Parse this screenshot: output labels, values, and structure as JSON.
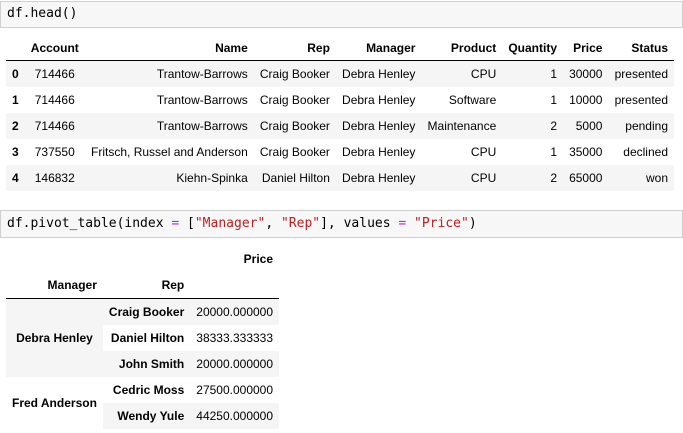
{
  "cell1": {
    "code": "df.head()"
  },
  "cell2": {
    "code_parts": [
      "df.pivot_table(index ",
      "=",
      " [",
      "\"Manager\"",
      ", ",
      "\"Rep\"",
      "], values ",
      "=",
      " ",
      "\"Price\"",
      ")"
    ]
  },
  "head_table": {
    "columns": [
      "Account",
      "Name",
      "Rep",
      "Manager",
      "Product",
      "Quantity",
      "Price",
      "Status"
    ],
    "rows": [
      {
        "index": "0",
        "values": [
          "714466",
          "Trantow-Barrows",
          "Craig Booker",
          "Debra Henley",
          "CPU",
          "1",
          "30000",
          "presented"
        ]
      },
      {
        "index": "1",
        "values": [
          "714466",
          "Trantow-Barrows",
          "Craig Booker",
          "Debra Henley",
          "Software",
          "1",
          "10000",
          "presented"
        ]
      },
      {
        "index": "2",
        "values": [
          "714466",
          "Trantow-Barrows",
          "Craig Booker",
          "Debra Henley",
          "Maintenance",
          "2",
          "5000",
          "pending"
        ]
      },
      {
        "index": "3",
        "values": [
          "737550",
          "Fritsch, Russel and Anderson",
          "Craig Booker",
          "Debra Henley",
          "CPU",
          "1",
          "35000",
          "declined"
        ]
      },
      {
        "index": "4",
        "values": [
          "146832",
          "Kiehn-Spinka",
          "Daniel Hilton",
          "Debra Henley",
          "CPU",
          "2",
          "65000",
          "won"
        ]
      }
    ]
  },
  "pivot_table": {
    "value_column": "Price",
    "index_names": [
      "Manager",
      "Rep"
    ],
    "groups": [
      {
        "manager": "Debra Henley",
        "rows": [
          {
            "rep": "Craig Booker",
            "price": "20000.000000"
          },
          {
            "rep": "Daniel Hilton",
            "price": "38333.333333"
          },
          {
            "rep": "John Smith",
            "price": "20000.000000"
          }
        ]
      },
      {
        "manager": "Fred Anderson",
        "rows": [
          {
            "rep": "Cedric Moss",
            "price": "27500.000000"
          },
          {
            "rep": "Wendy Yule",
            "price": "44250.000000"
          }
        ]
      }
    ]
  }
}
